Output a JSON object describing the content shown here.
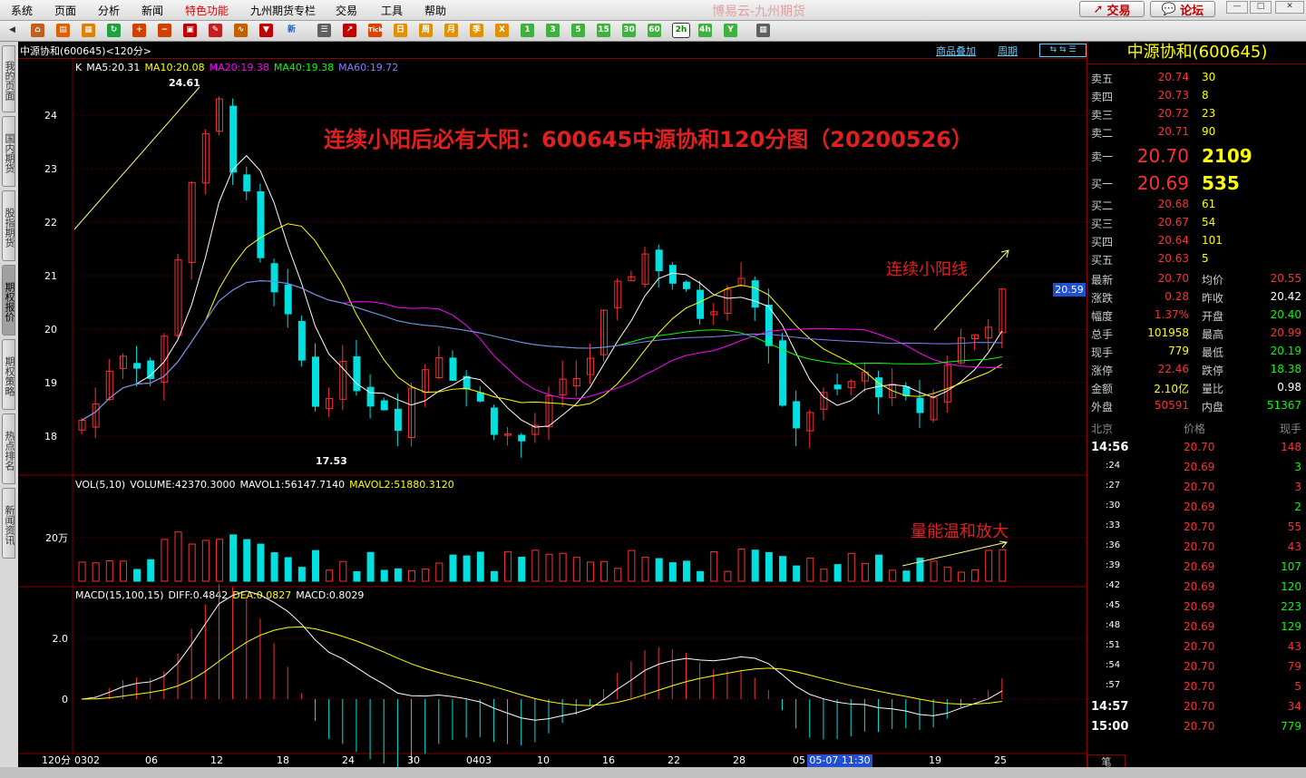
{
  "menu": [
    "系统",
    "页面",
    "分析",
    "新闻",
    "特色功能",
    "九州期货专栏",
    "交易",
    "工具",
    "帮助"
  ],
  "app_title": "博易云-九州期货",
  "buttons": {
    "trade": "交易",
    "forum": "论坛"
  },
  "toolbar_labels": {
    "tick": "Tick",
    "day": "日",
    "week": "周",
    "month": "月",
    "season": "季",
    "x": "X",
    "m1": "1",
    "m3": "3",
    "m5": "5",
    "m15": "15",
    "m30": "30",
    "m60": "60",
    "m120": "2h",
    "m240": "4h",
    "year": "Y"
  },
  "sidebar_tabs": [
    "我的页面",
    "国内期货",
    "股指期货",
    "期权报价",
    "期权策略",
    "热点排名",
    "新闻资讯"
  ],
  "chart": {
    "header": "中源协和(600645)<120分>",
    "overlay_link": "商品叠加",
    "period_link": "周期",
    "ma_legend": [
      {
        "text": "K",
        "color": "#ffffff"
      },
      {
        "text": "MA5:20.31",
        "color": "#ffffff"
      },
      {
        "text": "MA10:20.08",
        "color": "#ffff00"
      },
      {
        "text": "MA20:19.38",
        "color": "#ff00ff"
      },
      {
        "text": "MA40:19.38",
        "color": "#00ff00"
      },
      {
        "text": "MA60:19.72",
        "color": "#8080ff"
      }
    ],
    "price_labels": [
      "24",
      "23",
      "22",
      "21",
      "20",
      "19",
      "18"
    ],
    "high_mark": "24.61",
    "low_mark": "17.53",
    "current_price_tag": "20.59",
    "title_annotation": "连续小阳后必有大阳：600645中源协和120分图（20200526）",
    "small_yang_note": "连续小阳线",
    "vol_legend": [
      {
        "text": "VOL(5,10)",
        "color": "#ffffff"
      },
      {
        "text": "VOLUME:42370.3000",
        "color": "#ffffff"
      },
      {
        "text": "MAVOL1:56147.7140",
        "color": "#ffffff"
      },
      {
        "text": "MAVOL2:51880.3120",
        "color": "#ffff00"
      }
    ],
    "vol_label": "20万",
    "vol_note": "量能温和放大",
    "macd_legend": [
      {
        "text": "MACD(15,100,15)",
        "color": "#ffffff"
      },
      {
        "text": "DIFF:0.4842",
        "color": "#ffffff"
      },
      {
        "text": "DEA:0.0827",
        "color": "#ffff00"
      },
      {
        "text": "MACD:0.8029",
        "color": "#ffffff"
      }
    ],
    "macd_labels": [
      "2.0",
      "0"
    ],
    "x_period": "120分",
    "x_labels": [
      "0302",
      "06",
      "12",
      "18",
      "24",
      "30",
      "0403",
      "10",
      "16",
      "22",
      "28",
      "05",
      "19",
      "25"
    ],
    "cursor_time": "05-07 11:30"
  },
  "quote": {
    "title": "中源协和(600645)",
    "asks": [
      {
        "label": "卖五",
        "price": "20.74",
        "vol": "30"
      },
      {
        "label": "卖四",
        "price": "20.73",
        "vol": "8"
      },
      {
        "label": "卖三",
        "price": "20.72",
        "vol": "23"
      },
      {
        "label": "卖二",
        "price": "20.71",
        "vol": "90"
      }
    ],
    "ask1": {
      "label": "卖一",
      "price": "20.70",
      "vol": "2109"
    },
    "bid1": {
      "label": "买一",
      "price": "20.69",
      "vol": "535"
    },
    "bids": [
      {
        "label": "买二",
        "price": "20.68",
        "vol": "61"
      },
      {
        "label": "买三",
        "price": "20.67",
        "vol": "54"
      },
      {
        "label": "买四",
        "price": "20.64",
        "vol": "101"
      },
      {
        "label": "买五",
        "price": "20.63",
        "vol": "5"
      }
    ],
    "stats": [
      {
        "l1": "最新",
        "v1": "20.70",
        "c1": "#ff3030",
        "l2": "均价",
        "v2": "20.55",
        "c2": "#ff3030"
      },
      {
        "l1": "涨跌",
        "v1": "0.28",
        "c1": "#ff3030",
        "l2": "昨收",
        "v2": "20.42",
        "c2": "#ffffff"
      },
      {
        "l1": "幅度",
        "v1": "1.37%",
        "c1": "#ff3030",
        "l2": "开盘",
        "v2": "20.40",
        "c2": "#00ff00"
      },
      {
        "l1": "总手",
        "v1": "101958",
        "c1": "#ffff00",
        "l2": "最高",
        "v2": "20.99",
        "c2": "#ff3030"
      },
      {
        "l1": "现手",
        "v1": "779",
        "c1": "#ffff00",
        "l2": "最低",
        "v2": "20.19",
        "c2": "#00ff00"
      },
      {
        "l1": "涨停",
        "v1": "22.46",
        "c1": "#ff3030",
        "l2": "跌停",
        "v2": "18.38",
        "c2": "#00ff00"
      },
      {
        "l1": "金额",
        "v1": "2.10亿",
        "c1": "#ffff00",
        "l2": "量比",
        "v2": "0.98",
        "c2": "#ffffff"
      },
      {
        "l1": "外盘",
        "v1": "50591",
        "c1": "#ff3030",
        "l2": "内盘",
        "v2": "51367",
        "c2": "#00ff00"
      }
    ],
    "tick_header": {
      "time": "北京",
      "price": "价格",
      "vol": "现手"
    },
    "ticks": [
      {
        "time": "14:56",
        "price": "20.70",
        "vol": "148",
        "pc": "#ff3030",
        "vc": "#ff3030",
        "big": true
      },
      {
        "time": ":24",
        "price": "20.69",
        "vol": "3",
        "pc": "#ff3030",
        "vc": "#00ff00",
        "big": false
      },
      {
        "time": ":27",
        "price": "20.70",
        "vol": "3",
        "pc": "#ff3030",
        "vc": "#ff3030",
        "big": false
      },
      {
        "time": ":30",
        "price": "20.69",
        "vol": "2",
        "pc": "#ff3030",
        "vc": "#00ff00",
        "big": false
      },
      {
        "time": ":33",
        "price": "20.70",
        "vol": "55",
        "pc": "#ff3030",
        "vc": "#ff3030",
        "big": false
      },
      {
        "time": ":36",
        "price": "20.70",
        "vol": "43",
        "pc": "#ff3030",
        "vc": "#ff3030",
        "big": false
      },
      {
        "time": ":39",
        "price": "20.69",
        "vol": "107",
        "pc": "#ff3030",
        "vc": "#00ff00",
        "big": false
      },
      {
        "time": ":42",
        "price": "20.69",
        "vol": "120",
        "pc": "#ff3030",
        "vc": "#00ff00",
        "big": false
      },
      {
        "time": ":45",
        "price": "20.69",
        "vol": "223",
        "pc": "#ff3030",
        "vc": "#00ff00",
        "big": false
      },
      {
        "time": ":48",
        "price": "20.69",
        "vol": "129",
        "pc": "#ff3030",
        "vc": "#00ff00",
        "big": false
      },
      {
        "time": ":51",
        "price": "20.70",
        "vol": "43",
        "pc": "#ff3030",
        "vc": "#ff3030",
        "big": false
      },
      {
        "time": ":54",
        "price": "20.70",
        "vol": "79",
        "pc": "#ff3030",
        "vc": "#ff3030",
        "big": false
      },
      {
        "time": ":57",
        "price": "20.70",
        "vol": "5",
        "pc": "#ff3030",
        "vc": "#ff3030",
        "big": false
      },
      {
        "time": "14:57",
        "price": "20.70",
        "vol": "34",
        "pc": "#ff3030",
        "vc": "#ff3030",
        "big": true
      },
      {
        "time": "15:00",
        "price": "20.70",
        "vol": "779",
        "pc": "#ff3030",
        "vc": "#00ff00",
        "big": true
      }
    ],
    "footer_tab": "笔"
  }
}
